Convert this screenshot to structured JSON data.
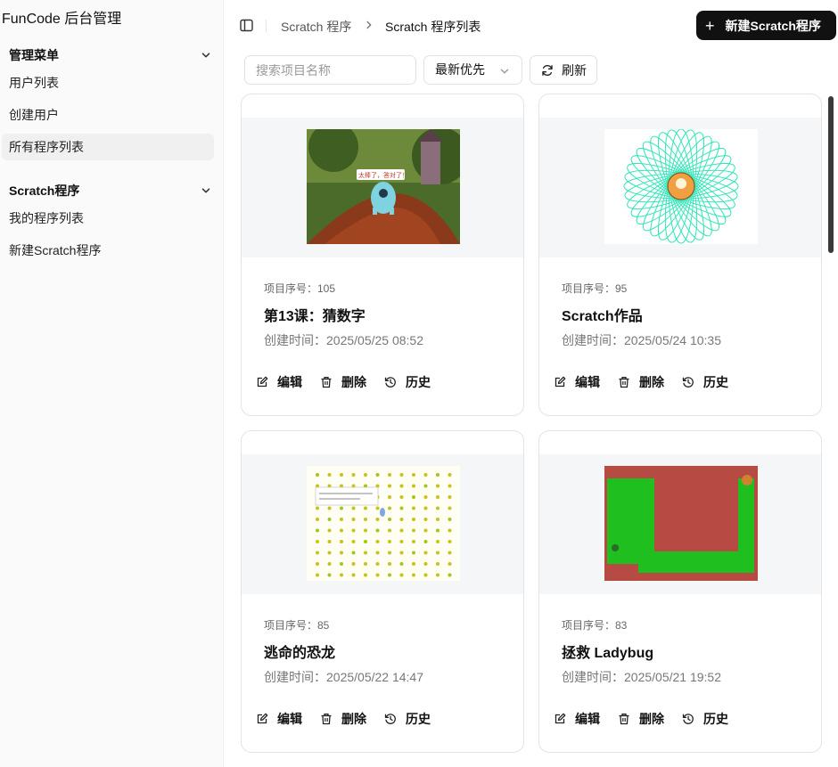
{
  "app": {
    "brand": "FunCode 后台管理"
  },
  "sidebar": {
    "groups": [
      {
        "title": "管理菜单",
        "items": [
          {
            "label": "用户列表"
          },
          {
            "label": "创建用户"
          },
          {
            "label": "所有程序列表"
          }
        ]
      },
      {
        "title": "Scratch程序",
        "items": [
          {
            "label": "我的程序列表"
          },
          {
            "label": "新建Scratch程序"
          }
        ]
      }
    ]
  },
  "header": {
    "breadcrumb": [
      "Scratch 程序",
      "Scratch 程序列表"
    ],
    "new_button": "新建Scratch程序"
  },
  "toolbar": {
    "search_placeholder": "搜索项目名称",
    "search_value": "",
    "sort_selected": "最新优先",
    "refresh_label": "刷新"
  },
  "cards": [
    {
      "id_label": "项目序号：105",
      "title": "第13课：猜数字",
      "created": "创建时间：2025/05/25 08:52",
      "thumb_text": "太棒了，答对了！"
    },
    {
      "id_label": "项目序号：95",
      "title": "Scratch作品",
      "created": "创建时间：2025/05/24 10:35"
    },
    {
      "id_label": "项目序号：85",
      "title": "逃命的恐龙",
      "created": "创建时间：2025/05/22 14:47"
    },
    {
      "id_label": "项目序号：83",
      "title": "拯救 Ladybug",
      "created": "创建时间：2025/05/21 19:52"
    }
  ],
  "actions": {
    "edit": "编辑",
    "delete": "删除",
    "history": "历史"
  },
  "colors": {
    "primary_button": "#111111",
    "sidebar_bg": "#fafafa",
    "thumb_bg": "#f5f6f7"
  }
}
